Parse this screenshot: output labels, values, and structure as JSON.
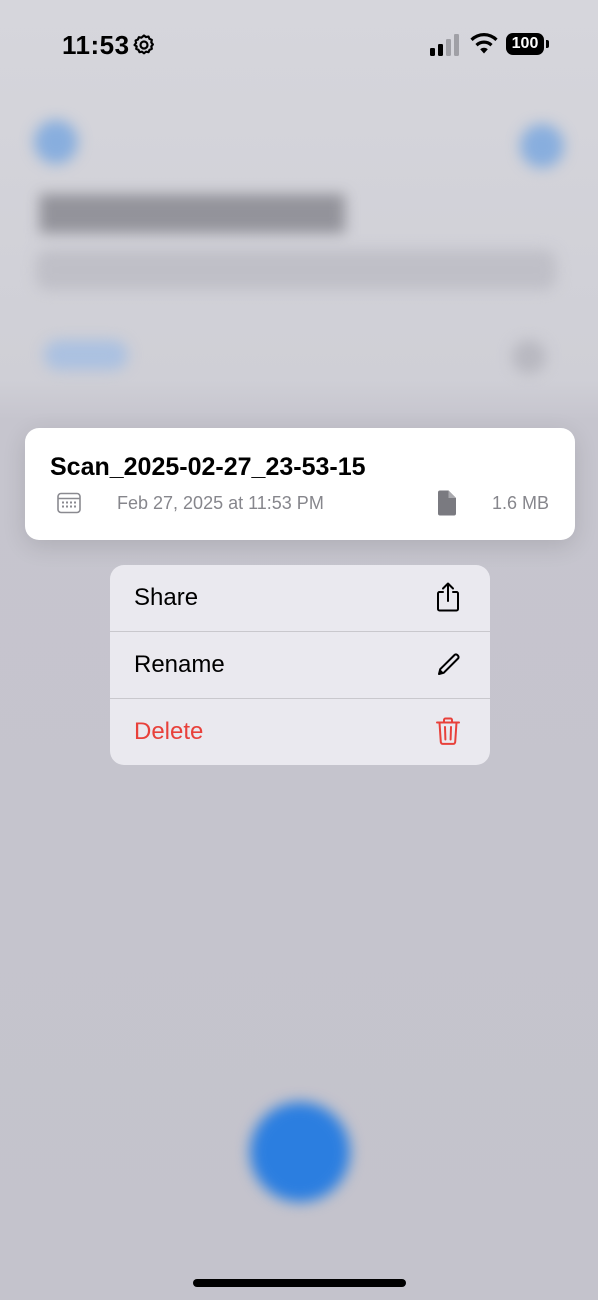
{
  "status_bar": {
    "time": "11:53",
    "battery": "100"
  },
  "preview": {
    "file_name": "Scan_2025-02-27_23-53-15",
    "date": "Feb 27, 2025 at 11:53 PM",
    "size": "1.6 MB"
  },
  "menu": {
    "items": [
      {
        "label": "Share",
        "icon": "share-icon"
      },
      {
        "label": "Rename",
        "icon": "pencil-icon"
      },
      {
        "label": "Delete",
        "icon": "trash-icon",
        "color": "#e8403a"
      }
    ]
  },
  "colors": {
    "accent": "#2b7ee0",
    "destructive": "#e8403a",
    "secondary_text": "#86868c"
  }
}
